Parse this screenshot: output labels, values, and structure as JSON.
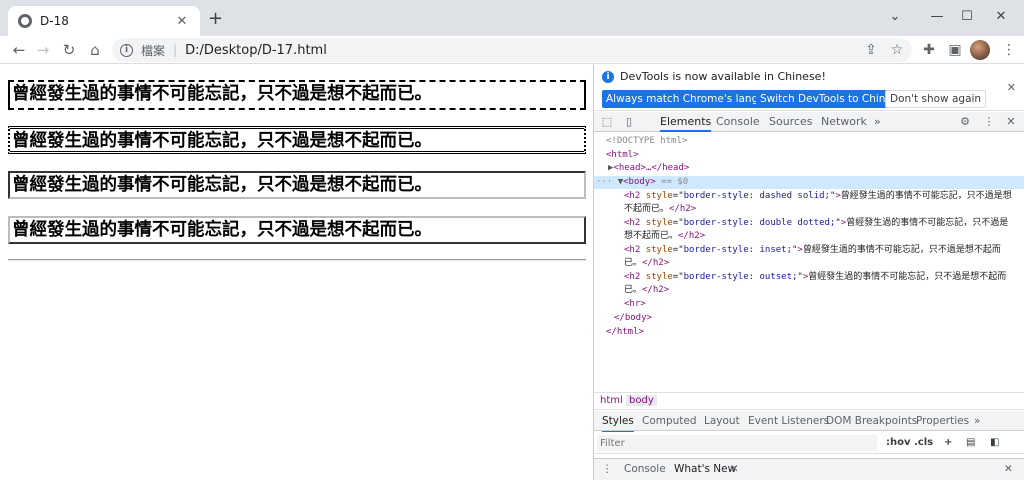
{
  "browser": {
    "tab_title": "D-18",
    "scheme_label": "檔案",
    "url": "D:/Desktop/D-17.html"
  },
  "page": {
    "headings": [
      "曾經發生過的事情不可能忘記，只不過是想不起而已。",
      "曾經發生過的事情不可能忘記，只不過是想不起而已。",
      "曾經發生過的事情不可能忘記，只不過是想不起而已。",
      "曾經發生過的事情不可能忘記，只不過是想不起而已。"
    ]
  },
  "devtools": {
    "info_message": "DevTools is now available in Chinese!",
    "btn_match": "Always match Chrome's language",
    "btn_switch": "Switch DevTools to Chinese",
    "btn_dont": "Don't show again",
    "tabs": [
      "Elements",
      "Console",
      "Sources",
      "Network"
    ],
    "more": "»",
    "dom": {
      "doctype": "<!DOCTYPE html>",
      "html_open": "<html>",
      "head": "<head>…</head>",
      "body_open": "<body>",
      "body_eq": "== $0",
      "h2_tag": "<h2",
      "style_attr": "style",
      "h2_close": "</h2>",
      "styles": [
        "border-style: dashed solid;",
        "border-style: double dotted;",
        "border-style: inset;",
        "border-style: outset;"
      ],
      "text_first": [
        "曾經發生過的事情不可能忘記，只不過是想",
        "曾經發生過的事情不可能忘記，只不過是",
        "曾經發生過的事情不可能忘記，只不過是想不起而",
        "曾經發生過的事情不可能忘記，只不過是想不起而"
      ],
      "text_second": [
        "不起而已。",
        "想不起而已。",
        "已。",
        "已。"
      ],
      "hr": "<hr>",
      "body_close": "</body>",
      "html_close": "</html>"
    },
    "breadcrumbs": [
      "html",
      "body"
    ],
    "style_tabs": [
      "Styles",
      "Computed",
      "Layout",
      "Event Listeners",
      "DOM Breakpoints",
      "Properties"
    ],
    "filter_placeholder": "Filter",
    "hov": ":hov",
    "cls": ".cls",
    "plus": "+",
    "drawer_tabs": [
      "Console",
      "What's New"
    ]
  },
  "colors": {
    "accent": "#1a73e8",
    "tag": "#881280",
    "attr": "#994500",
    "attr_value": "#1a1aa6",
    "selected_row": "#cfe8fc"
  }
}
